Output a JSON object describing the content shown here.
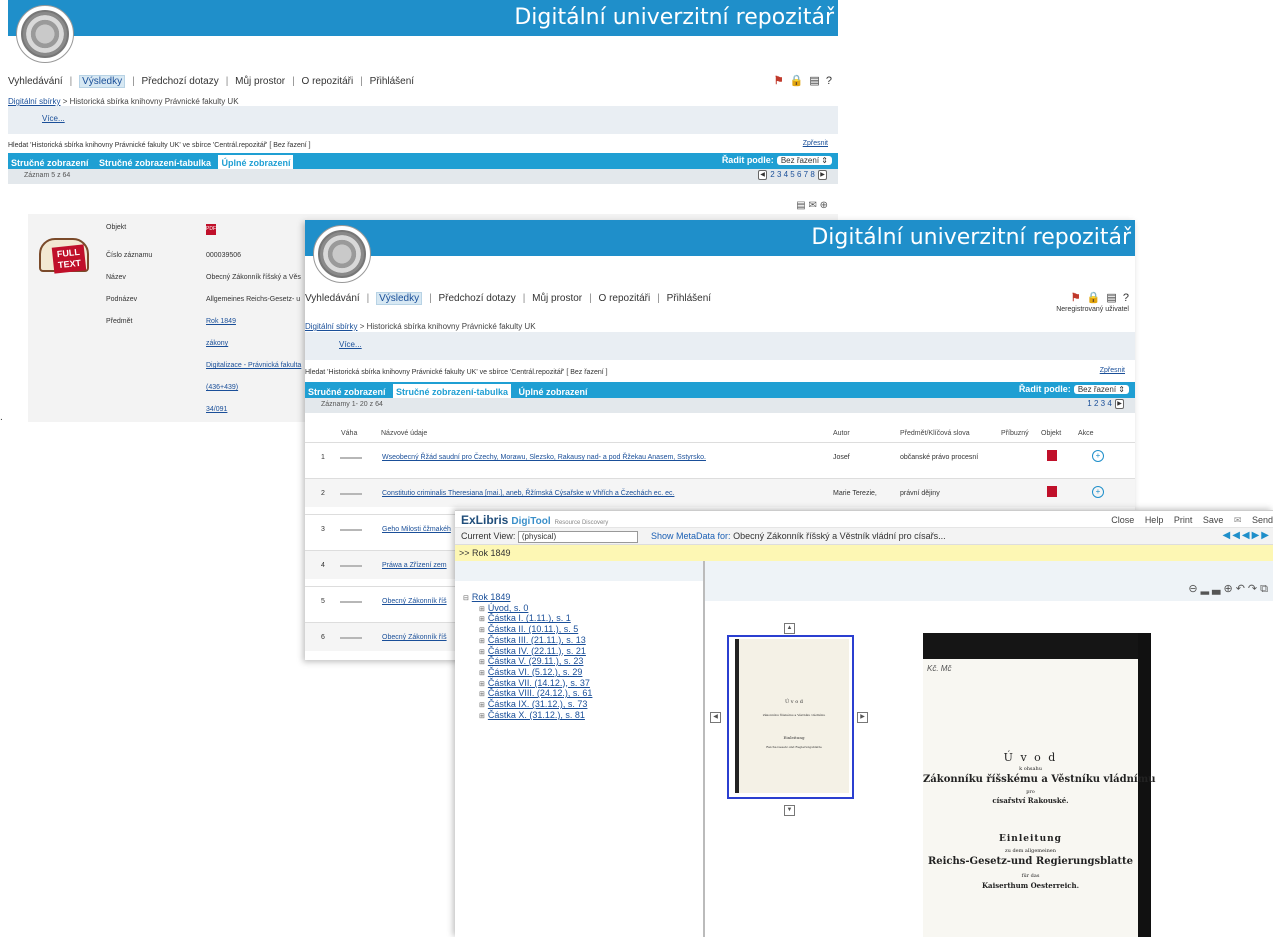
{
  "repo_title": "Digitální univerzitní repozitář",
  "nav": [
    "Vyhledávání",
    "Výsledky",
    "Předchozí dotazy",
    "Můj prostor",
    "O repozitáři",
    "Přihlášení"
  ],
  "breadcrumb": {
    "link": "Digitální sbírky",
    "rest": " > Historická sbírka knihovny Právnické fakulty UK"
  },
  "more_link": "Více...",
  "query_text": "Hledat 'Historická sbírka knihovny Právnické fakulty UK' ve sbírce 'Centrál.repozitář' [ Bez řazení ]",
  "refine_link": "Zpřesnit",
  "tabs": [
    "Stručné zobrazení",
    "Stručné zobrazení-tabulka",
    "Úplné zobrazení"
  ],
  "sort_label": "Řadit podle:",
  "sort_value": "Bez řazení",
  "window1": {
    "count_text": "Záznam 5 z 64",
    "pages": "2 3 4 5 6 7 8",
    "fulltext_badge": "FULL TEXT",
    "fields": [
      {
        "label": "Objekt",
        "value": ""
      },
      {
        "label": "Číslo záznamu",
        "value": "000039506"
      },
      {
        "label": "Název",
        "value": "Obecný Zákonník říšský a Věs"
      },
      {
        "label": "Podnázev",
        "value": "Allgemeines Reichs-Gesetz- u"
      },
      {
        "label": "Předmět",
        "value": "Rok 1849"
      },
      {
        "label": "",
        "value": "zákony"
      },
      {
        "label": "",
        "value": "Digitalizace - Právnická fakulta"
      },
      {
        "label": "",
        "value": "(436+439)"
      },
      {
        "label": "",
        "value": "34/091"
      }
    ]
  },
  "window2": {
    "user_text": "Neregistrovaný uživatel",
    "count_text": "Záznamy 1- 20 z 64",
    "pages": "1 2 3 4",
    "columns": [
      "Váha",
      "Názvové údaje",
      "Autor",
      "Předmět/Klíčová slova",
      "Příbuzný",
      "Objekt",
      "Akce"
    ],
    "rows": [
      {
        "num": "1",
        "title": "Wseobecný Řžád saudní pro Čzechy, Morawu, Slezsko, Rakausy nad- a pod Řžekau Anasem, Sstyrsko.",
        "author": "Josef",
        "subject": "občanské právo procesní"
      },
      {
        "num": "2",
        "title": "Constitutio criminalis Theresiana [mai.], aneb, Řžímská Cýsařske w Vhřích a Čzechách ec. ec.",
        "author": "Marie Terezie,",
        "subject": "právní dějiny"
      },
      {
        "num": "3",
        "title": "Geho Milosti čžmakéh",
        "author": "",
        "subject": ""
      },
      {
        "num": "4",
        "title": "Práwa a Zřízení zem",
        "author": "",
        "subject": ""
      },
      {
        "num": "5",
        "title": "Obecný Zákonník říš",
        "author": "",
        "subject": ""
      },
      {
        "num": "6",
        "title": "Obecný Zákonník říš",
        "author": "",
        "subject": ""
      }
    ]
  },
  "digitool": {
    "logo": "ExLibris",
    "product": "DigiTool",
    "tagline": "Resource Discovery",
    "menu": [
      "Close",
      "Help",
      "Print",
      "Save",
      "Send"
    ],
    "current_view_label": "Current View:",
    "current_view_value": "(physical)",
    "show_metadata": "Show MetaData for:",
    "metadata_title": "Obecný Zákonník říšský a Věstník vládní pro císařs...",
    "crumb": ">> Rok 1849",
    "tree_root": "Rok 1849",
    "tree_items": [
      "Úvod, s. 0",
      "Částka I. (1.11.), s. 1",
      "Částka II. (10.11.), s. 5",
      "Částka III. (21.11.), s. 13",
      "Částka IV. (22.11.), s. 21",
      "Částka V. (29.11.), s. 23",
      "Částka VI. (5.12.), s. 29",
      "Částka VII. (14.12.), s. 37",
      "Částka VIII. (24.12.), s. 61",
      "Částka IX. (31.12.), s. 73",
      "Částka X. (31.12.), s. 81"
    ],
    "page_text": {
      "corner": "Kč. Mč",
      "line1": "Ú v o d",
      "line2": "k ohsahu",
      "line3": "Zákonníku říšskému a Věstníku vládnímu",
      "line4": "pro",
      "line5": "císařství Rakouské.",
      "line6": "Einleitung",
      "line7": "zu dem allgemeinen",
      "line8": "Reichs-Gesetz-und Regierungsblatte",
      "line9": "für das",
      "line10": "Kaiserthum Oesterreich."
    }
  }
}
